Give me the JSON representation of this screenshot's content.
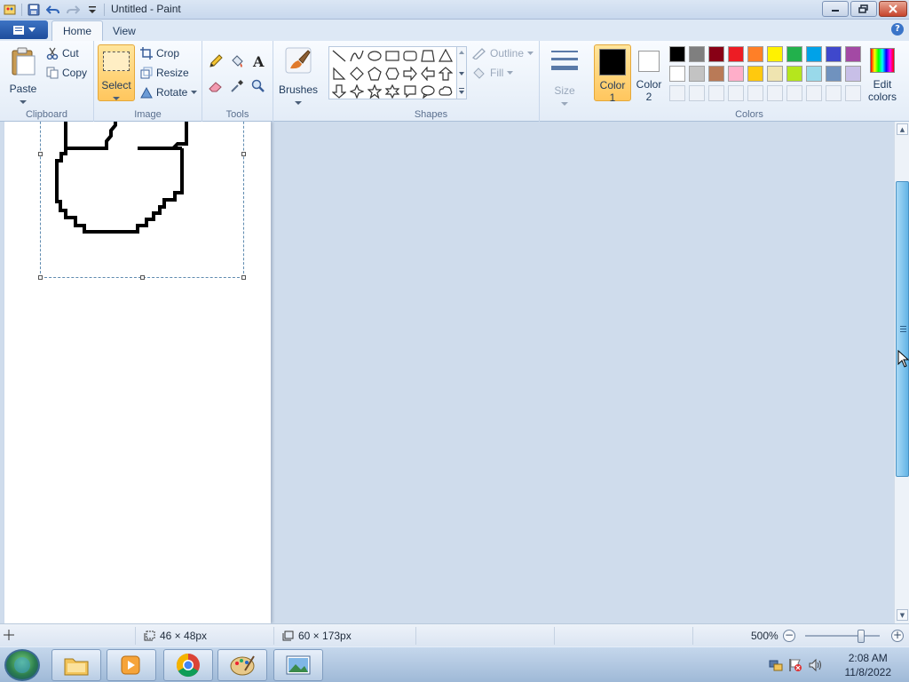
{
  "window": {
    "title": "Untitled - Paint"
  },
  "tabs": [
    {
      "label": "Home"
    },
    {
      "label": "View"
    }
  ],
  "ribbon": {
    "clipboard": {
      "label": "Clipboard",
      "paste": "Paste",
      "cut": "Cut",
      "copy": "Copy"
    },
    "image": {
      "label": "Image",
      "select": "Select",
      "crop": "Crop",
      "resize": "Resize",
      "rotate": "Rotate"
    },
    "tools": {
      "label": "Tools"
    },
    "brushes": {
      "label": "Brushes"
    },
    "shapes": {
      "label": "Shapes",
      "outline": "Outline",
      "fill": "Fill"
    },
    "size": {
      "label": "Size"
    },
    "colors": {
      "label": "Colors",
      "color1": "Color",
      "color1_num": "1",
      "color2": "Color",
      "color2_num": "2",
      "edit_colors_1": "Edit",
      "edit_colors_2": "colors",
      "color1_value": "#000000",
      "color2_value": "#ffffff",
      "palette_row1": [
        "#000000",
        "#7f7f7f",
        "#880015",
        "#ed1c24",
        "#ff7f27",
        "#fff200",
        "#22b14c",
        "#00a2e8",
        "#3f48cc",
        "#a349a4"
      ],
      "palette_row2": [
        "#ffffff",
        "#c3c3c3",
        "#b97a57",
        "#ffaec9",
        "#ffc90e",
        "#efe4b0",
        "#b5e61d",
        "#99d9ea",
        "#7092be",
        "#c8bfe7"
      ]
    }
  },
  "status": {
    "selection_size": "46 × 48px",
    "image_size": "60 × 173px",
    "zoom": "500%"
  },
  "taskbar": {
    "time": "2:08 AM",
    "date": "11/8/2022"
  }
}
